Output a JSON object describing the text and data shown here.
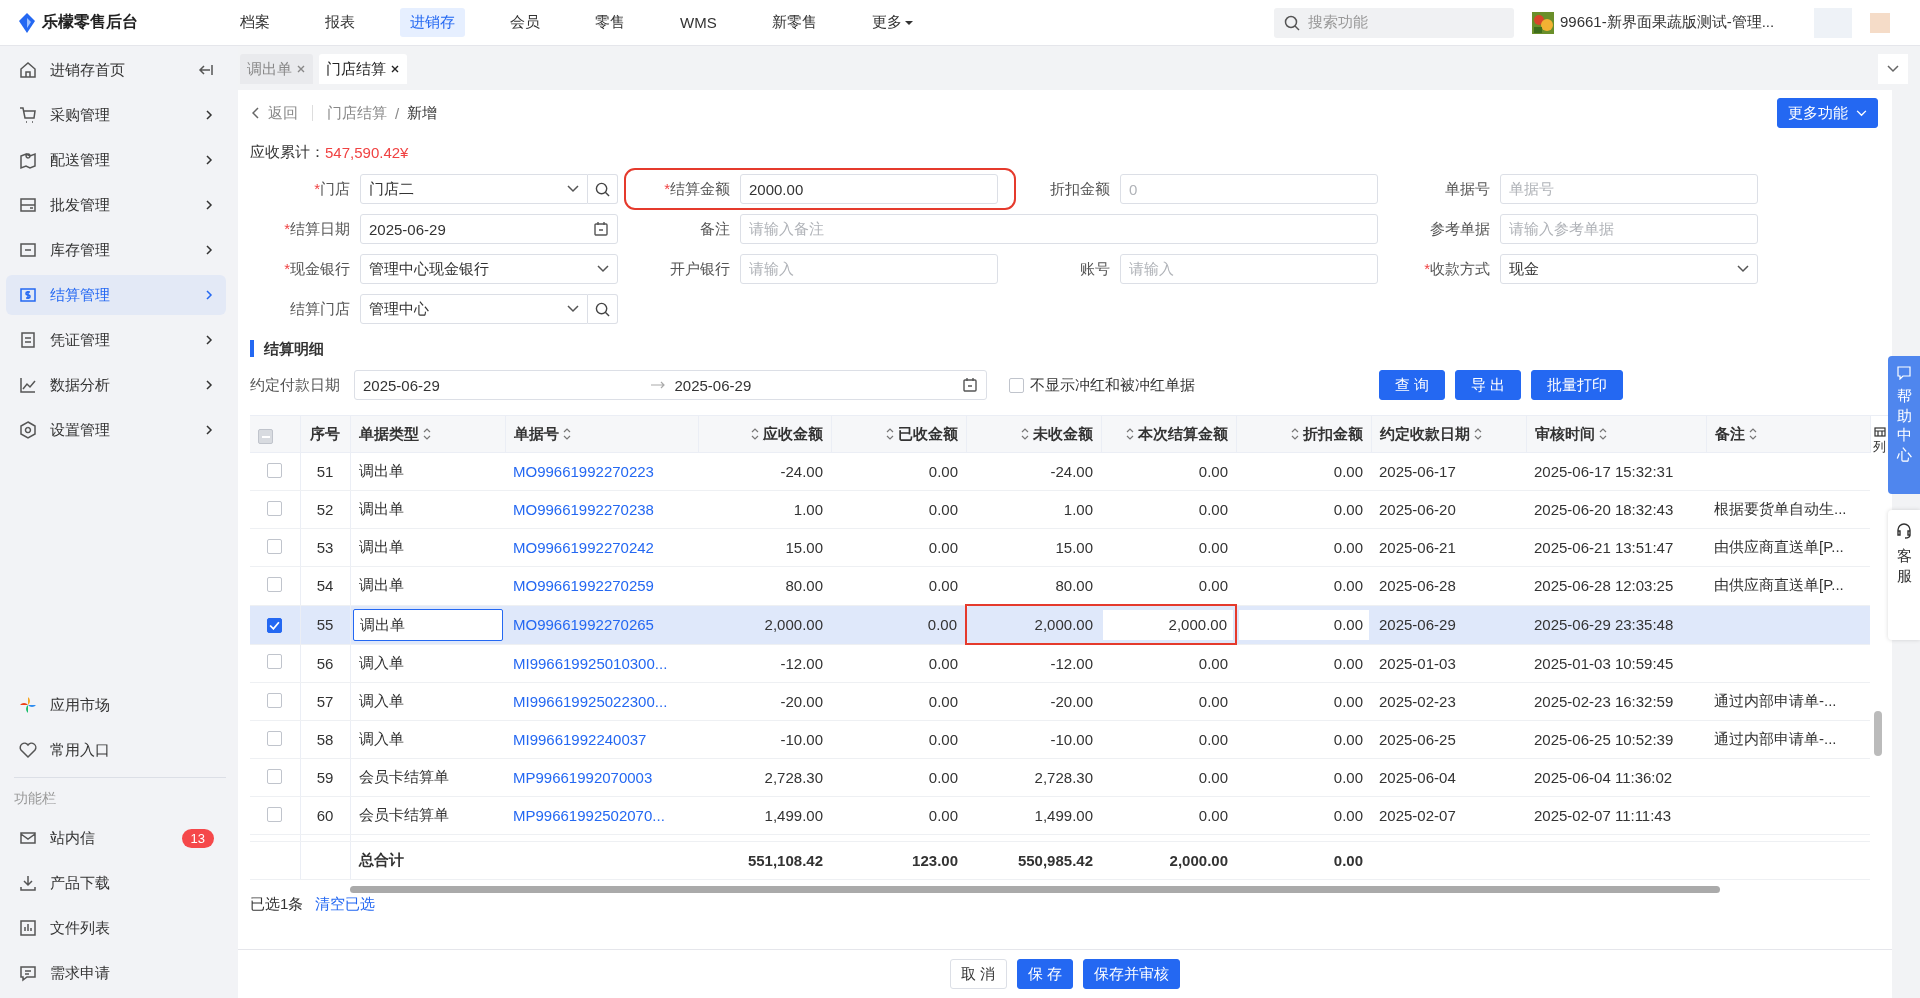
{
  "header": {
    "logo": "乐檬零售后台",
    "nav": [
      {
        "label": "档案",
        "selected": false
      },
      {
        "label": "报表",
        "selected": false
      },
      {
        "label": "进销存",
        "selected": true
      },
      {
        "label": "会员",
        "selected": false
      },
      {
        "label": "零售",
        "selected": false
      },
      {
        "label": "WMS",
        "selected": false
      },
      {
        "label": "新零售",
        "selected": false
      },
      {
        "label": "更多",
        "selected": false,
        "dropdown": true
      }
    ],
    "search": {
      "placeholder": "搜索功能"
    },
    "store": "99661-新界面果蔬版测试-管理..."
  },
  "sidebar": {
    "items": [
      {
        "label": "进销存首页",
        "selected": false
      },
      {
        "label": "采购管理",
        "selected": false
      },
      {
        "label": "配送管理",
        "selected": false
      },
      {
        "label": "批发管理",
        "selected": false
      },
      {
        "label": "库存管理",
        "selected": false
      },
      {
        "label": "结算管理",
        "selected": true
      },
      {
        "label": "凭证管理",
        "selected": false
      },
      {
        "label": "数据分析",
        "selected": false
      },
      {
        "label": "设置管理",
        "selected": false
      }
    ],
    "bottom_items": [
      {
        "label": "应用市场"
      },
      {
        "label": "常用入口"
      }
    ],
    "section_title": "功能栏",
    "tools": [
      {
        "label": "站内信",
        "badge": "13"
      },
      {
        "label": "产品下载"
      },
      {
        "label": "文件列表"
      },
      {
        "label": "需求申请"
      }
    ]
  },
  "tabs": [
    {
      "label": "调出单",
      "selected": false
    },
    {
      "label": "门店结算",
      "selected": true
    }
  ],
  "breadcrumb": {
    "back": "返回",
    "separator": "/",
    "path": [
      "门店结算",
      "新增"
    ]
  },
  "more_button": "更多功能",
  "receivable": {
    "label": "应收累计：",
    "value": "547,590.42¥"
  },
  "form": {
    "required_mark": "*",
    "rows": [
      [
        {
          "label": "门店",
          "required": true,
          "kind": "select",
          "value": "门店二",
          "search": true
        },
        {
          "label": "结算金额",
          "required": true,
          "kind": "text",
          "value": "2000.00",
          "highlighted": true
        },
        {
          "label": "折扣金额",
          "required": false,
          "kind": "text",
          "placeholder": "0"
        },
        {
          "label": "单据号",
          "required": false,
          "kind": "text",
          "placeholder": "单据号"
        }
      ],
      [
        {
          "label": "结算日期",
          "required": true,
          "kind": "date",
          "value": "2025-06-29"
        },
        {
          "label": "备注",
          "required": false,
          "kind": "text",
          "placeholder": "请输入备注",
          "colspan": 2
        },
        {
          "label": "参考单据",
          "required": false,
          "kind": "text",
          "placeholder": "请输入参考单据"
        }
      ],
      [
        {
          "label": "现金银行",
          "required": true,
          "kind": "select",
          "value": "管理中心现金银行"
        },
        {
          "label": "开户银行",
          "required": false,
          "kind": "text",
          "placeholder": "请输入"
        },
        {
          "label": "账号",
          "required": false,
          "kind": "text",
          "placeholder": "请输入"
        },
        {
          "label": "收款方式",
          "required": true,
          "kind": "select",
          "value": "现金"
        }
      ],
      [
        {
          "label": "结算门店",
          "required": false,
          "kind": "select",
          "value": "管理中心",
          "search": true
        }
      ]
    ]
  },
  "section_title": "结算明细",
  "filter": {
    "label": "约定付款日期",
    "from": "2025-06-29",
    "to": "2025-06-29",
    "checkbox": {
      "label": "不显示冲红和被冲红单据",
      "checked": false
    },
    "buttons": [
      "查 询",
      "导 出",
      "批量打印"
    ]
  },
  "table": {
    "partially_checked": true,
    "columns": [
      {
        "label": "序号",
        "kind": "index",
        "sortable": false
      },
      {
        "label": "单据类型",
        "kind": "text",
        "sortable": true,
        "editable": true
      },
      {
        "label": "单据号",
        "kind": "link",
        "sortable": true
      },
      {
        "label": "应收金额",
        "kind": "amount",
        "sortable": true
      },
      {
        "label": "已收金额",
        "kind": "amount",
        "sortable": true
      },
      {
        "label": "未收金额",
        "kind": "amount",
        "sortable": true,
        "in_mark": true
      },
      {
        "label": "本次结算金额",
        "kind": "amount",
        "sortable": true,
        "editable": true,
        "in_mark": true
      },
      {
        "label": "折扣金额",
        "kind": "amount",
        "sortable": true,
        "editable": true
      },
      {
        "label": "约定收款日期",
        "kind": "text",
        "sortable": true
      },
      {
        "label": "审核时间",
        "kind": "text",
        "sortable": true
      },
      {
        "label": "备注",
        "kind": "text",
        "sortable": true
      }
    ],
    "settings_label": "列",
    "rows": [
      {
        "checked": false,
        "marked": false,
        "cells": [
          "51",
          "调出单",
          "MO99661992270223",
          "-24.00",
          "0.00",
          "-24.00",
          "0.00",
          "0.00",
          "2025-06-17",
          "2025-06-17 15:32:31"
        ]
      },
      {
        "checked": false,
        "marked": false,
        "cells": [
          "52",
          "调出单",
          "MO99661992270238",
          "1.00",
          "0.00",
          "1.00",
          "0.00",
          "0.00",
          "2025-06-20",
          "2025-06-20 18:32:43",
          "根据要货单自动生..."
        ]
      },
      {
        "checked": false,
        "marked": false,
        "cells": [
          "53",
          "调出单",
          "MO99661992270242",
          "15.00",
          "0.00",
          "15.00",
          "0.00",
          "0.00",
          "2025-06-21",
          "2025-06-21 13:51:47",
          "由供应商直送单[P..."
        ]
      },
      {
        "checked": false,
        "marked": false,
        "cells": [
          "54",
          "调出单",
          "MO99661992270259",
          "80.00",
          "0.00",
          "80.00",
          "0.00",
          "0.00",
          "2025-06-28",
          "2025-06-28 12:03:25",
          "由供应商直送单[P..."
        ]
      },
      {
        "checked": true,
        "marked": true,
        "cells": [
          "55",
          "调出单",
          "MO99661992270265",
          "2,000.00",
          "0.00",
          "2,000.00",
          "2,000.00",
          "0.00",
          "2025-06-29",
          "2025-06-29 23:35:48"
        ]
      },
      {
        "checked": false,
        "marked": false,
        "cells": [
          "56",
          "调入单",
          "MI996619925010300...",
          "-12.00",
          "0.00",
          "-12.00",
          "0.00",
          "0.00",
          "2025-01-03",
          "2025-01-03 10:59:45"
        ]
      },
      {
        "checked": false,
        "marked": false,
        "cells": [
          "57",
          "调入单",
          "MI996619925022300...",
          "-20.00",
          "0.00",
          "-20.00",
          "0.00",
          "0.00",
          "2025-02-23",
          "2025-02-23 16:32:59",
          "通过内部申请单-..."
        ]
      },
      {
        "checked": false,
        "marked": false,
        "cells": [
          "58",
          "调入单",
          "MI99661992240037",
          "-10.00",
          "0.00",
          "-10.00",
          "0.00",
          "0.00",
          "2025-06-25",
          "2025-06-25 10:52:39",
          "通过内部申请单-..."
        ]
      },
      {
        "checked": false,
        "marked": false,
        "cells": [
          "59",
          "会员卡结算单",
          "MP99661992070003",
          "2,728.30",
          "0.00",
          "2,728.30",
          "0.00",
          "0.00",
          "2025-06-04",
          "2025-06-04 11:36:02"
        ]
      },
      {
        "checked": false,
        "marked": false,
        "cells": [
          "60",
          "会员卡结算单",
          "MP99661992502070...",
          "1,499.00",
          "0.00",
          "1,499.00",
          "0.00",
          "0.00",
          "2025-02-07",
          "2025-02-07 11:11:43"
        ]
      }
    ],
    "totals": {
      "label": "总合计",
      "values": [
        "551,108.42",
        "123.00",
        "550,985.42",
        "2,000.00",
        "0.00"
      ]
    }
  },
  "selection": {
    "count": "已选1条",
    "clear": "清空已选"
  },
  "footer": {
    "buttons": [
      {
        "label": "取 消",
        "kind": "default"
      },
      {
        "label": "保 存",
        "kind": "primary"
      },
      {
        "label": "保存并审核",
        "kind": "primary"
      }
    ]
  },
  "float": {
    "help": "帮助中心",
    "service": "客服"
  }
}
